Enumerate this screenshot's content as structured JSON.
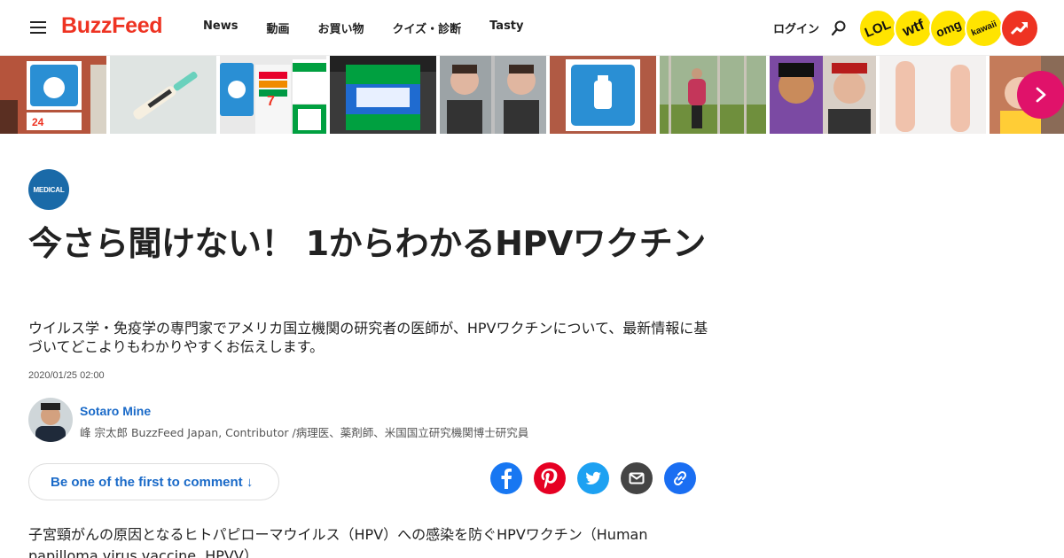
{
  "header": {
    "logo": "BuzzFeed",
    "nav": [
      "News",
      "動画",
      "お買い物",
      "クイズ・診断",
      "Tasty"
    ],
    "login": "ログイン",
    "badges": [
      "LOL",
      "wtf",
      "omg",
      "kawaii"
    ],
    "brand_color": "#ee3322"
  },
  "strip": {
    "tiles": [
      {
        "icon": "lawson-store-image"
      },
      {
        "icon": "mascara-image"
      },
      {
        "icon": "seven-eleven-familymart-image"
      },
      {
        "icon": "familymart-store-image"
      },
      {
        "icon": "man-reaction-image"
      },
      {
        "icon": "lawson-sign-image"
      },
      {
        "icon": "woman-orchard-image"
      },
      {
        "icon": "aladdin-image"
      },
      {
        "icon": "hands-image"
      },
      {
        "icon": "woman-smiling-image"
      }
    ]
  },
  "article": {
    "category": "MEDICAL",
    "title": "今さら聞けない！ 1からわかるHPVワクチン",
    "subtitle": "ウイルス学・免疫学の専門家でアメリカ国立機関の研究者の医師が、HPVワクチンについて、最新情報に基づいてどこよりもわかりやすくお伝えします。",
    "date": "2020/01/25 02:00",
    "author_name": "Sotaro Mine",
    "author_desc": "峰 宗太郎 BuzzFeed Japan, Contributor /病理医、薬剤師、米国国立研究機関博士研究員",
    "comment_cta": "Be one of the first to comment ↓",
    "body": "子宮頸がんの原因となるヒトパピローマウイルス（HPV）への感染を防ぐHPVワクチン（Human papilloma virus vaccine, HPVV）"
  }
}
